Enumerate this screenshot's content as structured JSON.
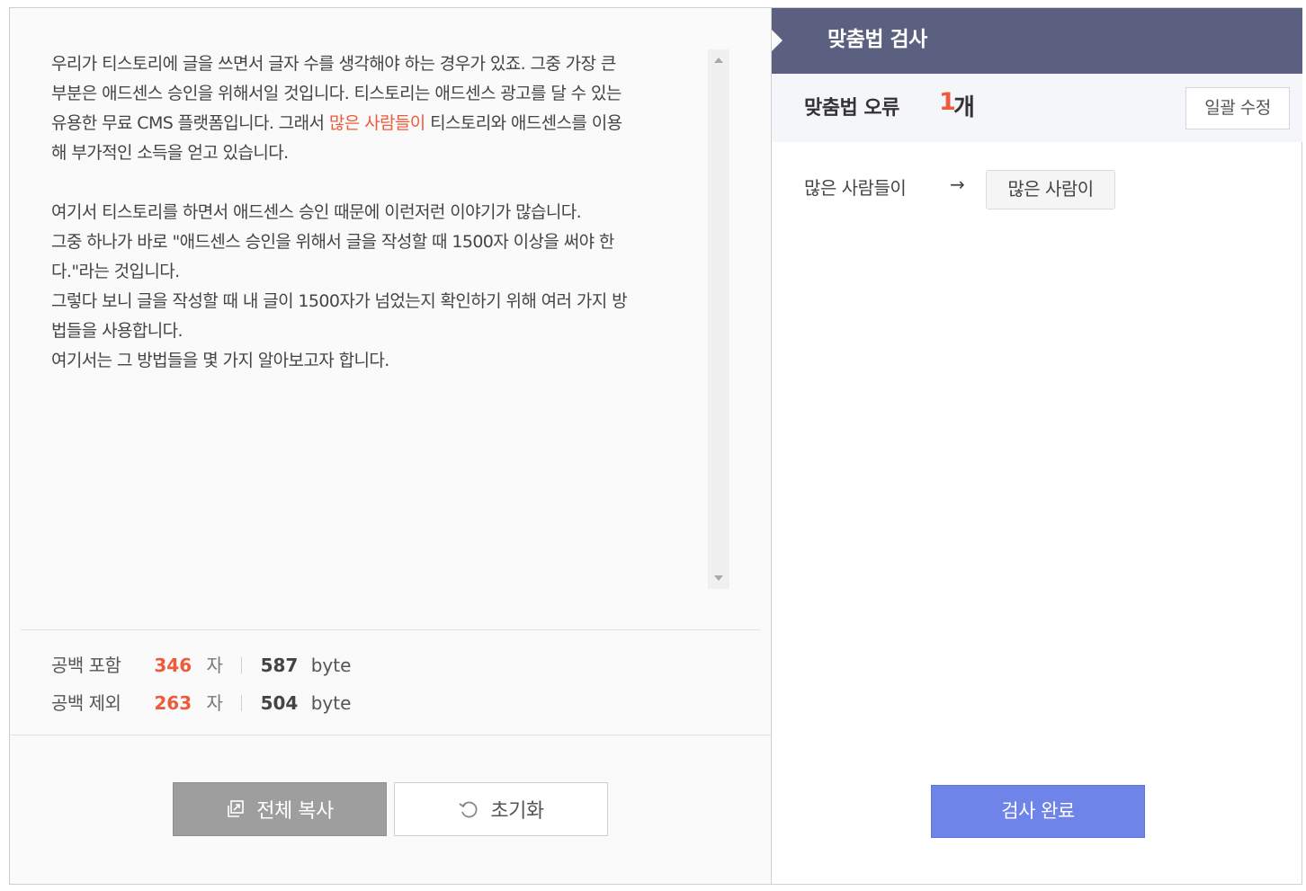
{
  "editor": {
    "paragraphs": [
      {
        "lines": [
          [
            {
              "t": "우리가 티스토리에 글을 쓰면서 글자 수를 생각해야 하는 경우가 있죠. 그중 가장 큰"
            }
          ],
          [
            {
              "t": "부분은 애드센스 승인을 위해서일 것입니다. 티스토리는 애드센스 광고를 달 수 있는"
            }
          ],
          [
            {
              "t": "유용한 무료 CMS 플랫폼입니다. 그래서 "
            },
            {
              "t": "많은 사람들이",
              "hl": true
            },
            {
              "t": " 티스토리와 애드센스를 이용"
            }
          ],
          [
            {
              "t": "해 부가적인 소득을 얻고 있습니다."
            }
          ]
        ]
      },
      {
        "lines": [
          [
            {
              "t": "여기서 티스토리를 하면서 애드센스 승인 때문에 이런저런 이야기가 많습니다."
            }
          ],
          [
            {
              "t": "그중 하나가 바로 \"애드센스 승인을 위해서 글을 작성할 때 1500자 이상을 써야 한"
            }
          ],
          [
            {
              "t": "다.\"라는 것입니다."
            }
          ],
          [
            {
              "t": "그렇다 보니 글을 작성할 때 내 글이 1500자가 넘었는지 확인하기 위해 여러 가지 방"
            }
          ],
          [
            {
              "t": "법들을 사용합니다."
            }
          ],
          [
            {
              "t": "여기서는 그 방법들을 몇 가지 알아보고자 합니다."
            }
          ]
        ]
      }
    ]
  },
  "stats": {
    "with_spaces": {
      "label": "공백 포함",
      "count": "346",
      "unit": "자",
      "bytes": "587",
      "byte_unit": "byte"
    },
    "without_spaces": {
      "label": "공백 제외",
      "count": "263",
      "unit": "자",
      "bytes": "504",
      "byte_unit": "byte"
    }
  },
  "buttons": {
    "copy_all": "전체 복사",
    "reset": "초기화",
    "done": "검사 완료",
    "fix_all": "일괄 수정"
  },
  "panel": {
    "title": "맞춤법 검사",
    "error_label": "맞춤법 오류",
    "error_count": "1",
    "error_unit": "개"
  },
  "corrections": [
    {
      "original": "많은 사람들이",
      "arrow": "→",
      "suggestion": "많은 사람이"
    }
  ],
  "colors": {
    "highlight": "#ef5a3a",
    "header_bg": "#5c6080",
    "done_button": "#6f84e8",
    "copy_button": "#9e9e9e"
  },
  "icons": [
    "copy-icon",
    "reset-icon",
    "scroll-up-icon",
    "scroll-down-icon",
    "arrow-right-icon"
  ]
}
